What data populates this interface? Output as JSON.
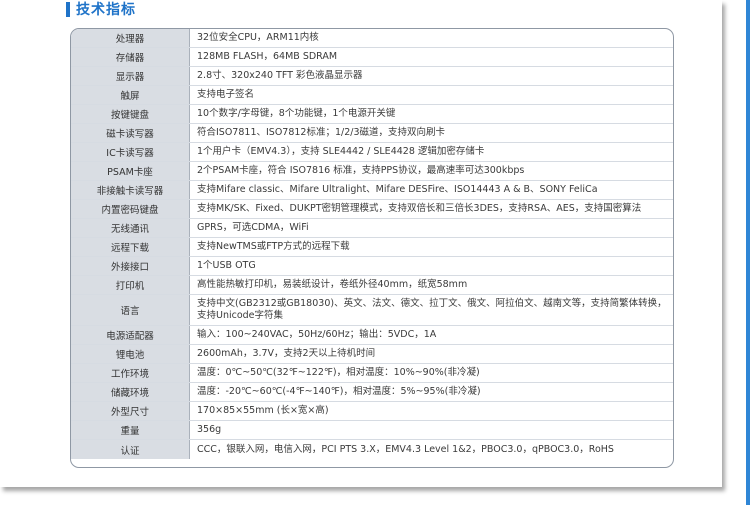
{
  "section": {
    "title": "技术指标"
  },
  "colors": {
    "accent": "#1f73c8",
    "label_bg": "#d9dde3",
    "border": "#8f98a4"
  },
  "specs": [
    {
      "label": "处理器",
      "value": "32位安全CPU，ARM11内核"
    },
    {
      "label": "存储器",
      "value": "128MB FLASH，64MB SDRAM"
    },
    {
      "label": "显示器",
      "value": "2.8寸、320x240 TFT 彩色液晶显示器"
    },
    {
      "label": "触屏",
      "value": "支持电子签名"
    },
    {
      "label": "按键键盘",
      "value": "10个数字/字母键，8个功能键，1个电源开关键"
    },
    {
      "label": "磁卡读写器",
      "value": "符合ISO7811、ISO7812标准；1/2/3磁道，支持双向刷卡"
    },
    {
      "label": "IC卡读写器",
      "value": "1个用户卡（EMV4.3），支持 SLE4442 / SLE4428 逻辑加密存储卡"
    },
    {
      "label": "PSAM卡座",
      "value": "2个PSAM卡座，符合 ISO7816 标准，支持PPS协议，最高速率可达300kbps"
    },
    {
      "label": "非接触卡读写器",
      "value": "支持Mifare classic、Mifare Ultralight、Mifare DESFire、ISO14443 A & B、SONY FeliCa"
    },
    {
      "label": "内置密码键盘",
      "value": "支持MK/SK、Fixed、DUKPT密钥管理模式，支持双倍长和三倍长3DES，支持RSA、AES，支持国密算法"
    },
    {
      "label": "无线通讯",
      "value": "GPRS，可选CDMA，WiFi"
    },
    {
      "label": "远程下载",
      "value": "支持NewTMS或FTP方式的远程下载"
    },
    {
      "label": "外接接口",
      "value": "1个USB OTG"
    },
    {
      "label": "打印机",
      "value": "高性能热敏打印机，易装纸设计，卷纸外径40mm，纸宽58mm"
    },
    {
      "label": "语言",
      "value": "支持中文(GB2312或GB18030)、英文、法文、德文、拉丁文、俄文、阿拉伯文、越南文等，支持简繁体转换，\n支持Unicode字符集"
    },
    {
      "label": "电源适配器",
      "value": "输入：100~240VAC，50Hz/60Hz；输出：5VDC，1A"
    },
    {
      "label": "锂电池",
      "value": "2600mAh，3.7V，支持2天以上待机时间"
    },
    {
      "label": "工作环境",
      "value": "温度：0℃~50℃(32℉~122℉)，相对温度：10%~90%(非冷凝)"
    },
    {
      "label": "储藏环境",
      "value": "温度：-20℃~60℃(-4℉~140℉)，相对温度：5%~95%(非冷凝)"
    },
    {
      "label": "外型尺寸",
      "value": "170×85×55mm (长×宽×高)"
    },
    {
      "label": "重量",
      "value": "356g"
    },
    {
      "label": "认证",
      "value": "CCC，银联入网，电信入网，PCI PTS 3.X，EMV4.3 Level 1&2，PBOC3.0，qPBOC3.0，RoHS"
    }
  ]
}
